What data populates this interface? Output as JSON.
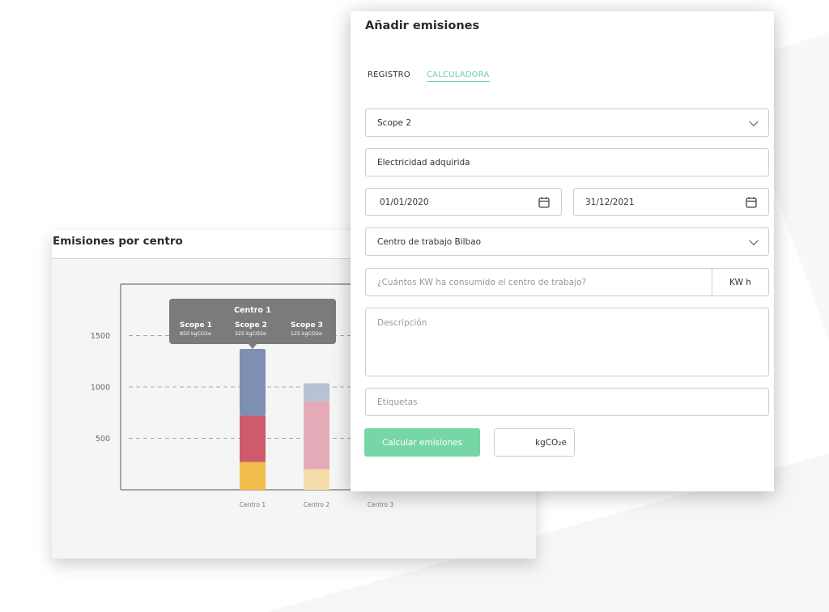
{
  "chart_card": {
    "title": "Emisiones por centro"
  },
  "chart_data": {
    "type": "bar",
    "stacked": true,
    "categories": [
      "Centro 1",
      "Centro 2",
      "Centro 3"
    ],
    "series": [
      {
        "values": [
          270,
          200,
          0
        ],
        "color": "#f0bd4c",
        "light_color": "#f5ddaa"
      },
      {
        "values": [
          450,
          0,
          0
        ],
        "color": "#cd5b6b",
        "light_color": "#e5aab7"
      },
      {
        "values": [
          650,
          660,
          0
        ],
        "color": "#7d8fb2",
        "light_color": "#b9c1d6"
      }
    ],
    "second_bar_layers": [
      200,
      660,
      175
    ],
    "y_ticks": [
      500,
      1000,
      1500
    ],
    "ylim": [
      0,
      2000
    ],
    "grid": "dashed horizontal",
    "tooltip": {
      "title": "Centro 1",
      "items": [
        {
          "label": "Scope 1",
          "value": "850 kgCO2e"
        },
        {
          "label": "Scope 2",
          "value": "325 kgCO2e"
        },
        {
          "label": "Scope 3",
          "value": "125 kgCO2e"
        }
      ]
    }
  },
  "form": {
    "title": "Añadir emisiones",
    "tabs": [
      {
        "label": "REGISTRO",
        "active": false
      },
      {
        "label": "CALCULADORA",
        "active": true
      }
    ],
    "scope_select": {
      "value": "Scope 2",
      "icon": "chevron-down-icon"
    },
    "category_field": {
      "value": "Electricidad adquirida"
    },
    "start_date": {
      "value": "01/01/2020",
      "icon": "calendar-icon"
    },
    "end_date": {
      "value": "31/12/2021",
      "icon": "calendar-icon"
    },
    "center_select": {
      "value": "Centro de trabajo Bilbao",
      "icon": "chevron-down-icon"
    },
    "consumption_field": {
      "placeholder": "¿Cuántos KW ha consumido el centro de trabajo?",
      "unit": "KW h"
    },
    "description_field": {
      "placeholder": "Descripción"
    },
    "tags_field": {
      "placeholder": "Etiquetas"
    },
    "calculate_button": {
      "label": "Calcular emisiones",
      "color": "#77d6a6"
    },
    "result_field": {
      "value": "",
      "unit": "kgCO₂e"
    }
  },
  "colors": {
    "accent": "#6fd3a0",
    "tooltip_bg": "#7b7b7b"
  }
}
